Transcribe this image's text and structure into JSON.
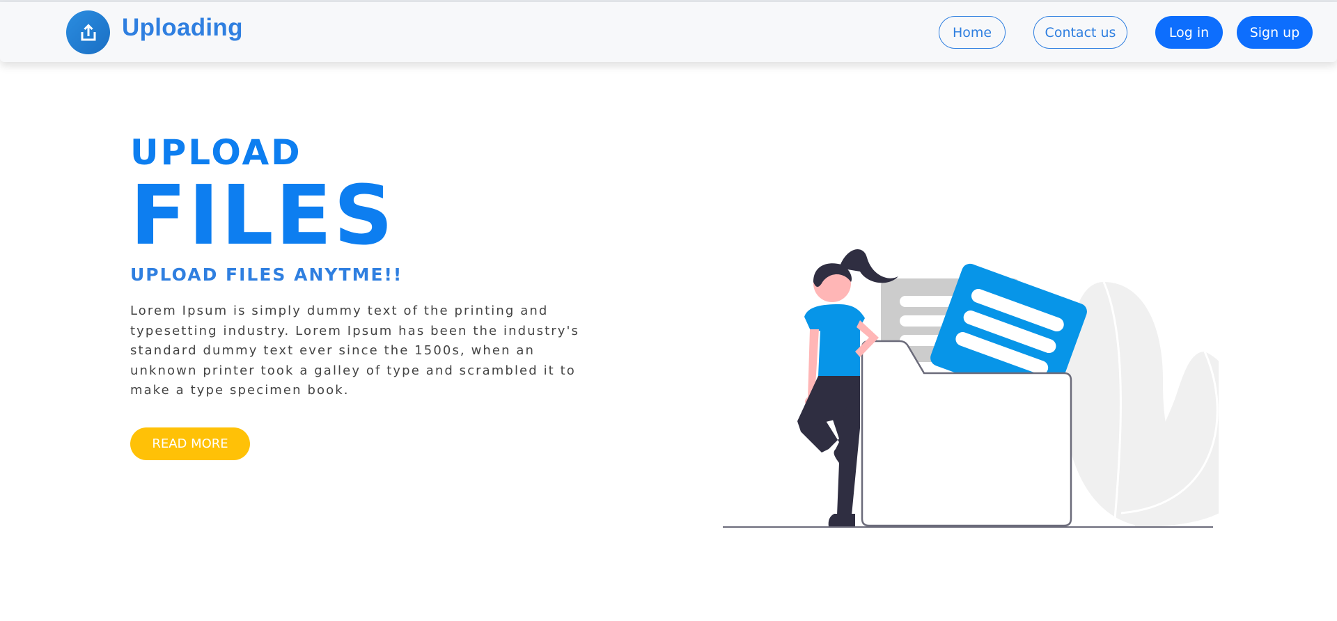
{
  "navbar": {
    "brand": "Uploading",
    "logo_icon": "upload-icon",
    "home_label": "Home",
    "contact_label": "Contact us",
    "login_label": "Log in",
    "signup_label": "Sign up"
  },
  "hero": {
    "title_line1": "UPLOAD",
    "title_line2": "FILES",
    "subtitle": "UPLOAD FILES ANYTME!!",
    "paragraph": "Lorem Ipsum is simply dummy text of the printing and typesetting industry. Lorem Ipsum has been the industry's standard dummy text ever since the 1500s, when an unknown printer took a galley of type and scrambled it to make a type specimen book.",
    "read_more_label": "READ MORE"
  },
  "colors": {
    "primary": "#0d6efd",
    "brand_blue": "#2f7fe0",
    "accent_yellow": "#ffc107",
    "illustration_blue": "#0795e8"
  }
}
